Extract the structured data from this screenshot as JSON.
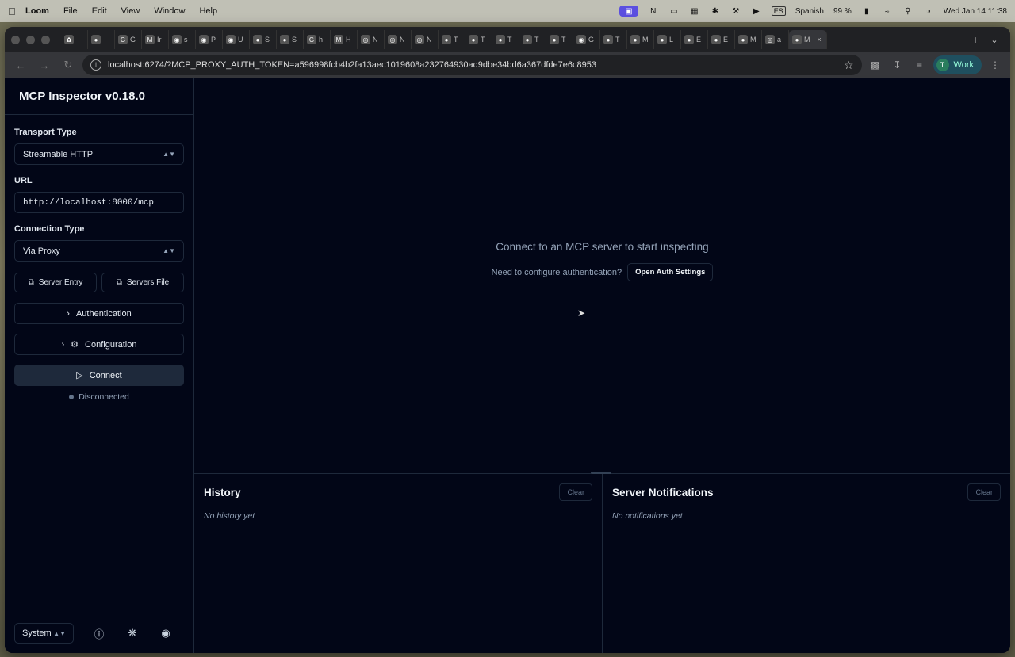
{
  "menubar": {
    "app": "Loom",
    "items": [
      "File",
      "Edit",
      "View",
      "Window",
      "Help"
    ],
    "input_source_badge": "ES",
    "input_source": "Spanish",
    "battery": "99 %",
    "datetime": "Wed Jan 14  11:38"
  },
  "browser": {
    "tabs": [
      {
        "icon": "openai-icon",
        "label": ""
      },
      {
        "icon": "app-icon",
        "label": ""
      },
      {
        "icon": "google-icon",
        "label": "G"
      },
      {
        "icon": "gmail-icon",
        "label": "Ir"
      },
      {
        "icon": "github-icon",
        "label": "s"
      },
      {
        "icon": "github-icon",
        "label": "P"
      },
      {
        "icon": "github-icon",
        "label": "U"
      },
      {
        "icon": "app-icon",
        "label": "S"
      },
      {
        "icon": "app-icon",
        "label": "S"
      },
      {
        "icon": "google-icon",
        "label": "h"
      },
      {
        "icon": "medium-icon",
        "label": "H"
      },
      {
        "icon": "globe-icon",
        "label": "N"
      },
      {
        "icon": "globe-icon",
        "label": "N"
      },
      {
        "icon": "globe-icon",
        "label": "N"
      },
      {
        "icon": "app-icon",
        "label": "T"
      },
      {
        "icon": "app-icon",
        "label": "T"
      },
      {
        "icon": "app-icon",
        "label": "T"
      },
      {
        "icon": "app-icon",
        "label": "T"
      },
      {
        "icon": "app-icon",
        "label": "T"
      },
      {
        "icon": "github-icon",
        "label": "G"
      },
      {
        "icon": "app-icon",
        "label": "T"
      },
      {
        "icon": "app-icon",
        "label": "M"
      },
      {
        "icon": "app-icon",
        "label": "L"
      },
      {
        "icon": "app-icon",
        "label": "E"
      },
      {
        "icon": "app-icon",
        "label": "E"
      },
      {
        "icon": "app-icon",
        "label": "M"
      },
      {
        "icon": "globe-icon",
        "label": "a"
      },
      {
        "icon": "app-icon",
        "label": "M",
        "active": true
      }
    ],
    "url": "localhost:6274/?MCP_PROXY_AUTH_TOKEN=a596998fcb4b2fa13aec1019608a232764930ad9dbe34bd6a367dfde7e6c8953",
    "profile_initial": "T",
    "profile_name": "Work"
  },
  "sidebar": {
    "title": "MCP Inspector v0.18.0",
    "transport_label": "Transport Type",
    "transport_value": "Streamable HTTP",
    "url_label": "URL",
    "url_value": "http://localhost:8000/mcp",
    "connection_label": "Connection Type",
    "connection_value": "Via Proxy",
    "server_entry": "Server Entry",
    "servers_file": "Servers File",
    "authentication": "Authentication",
    "configuration": "Configuration",
    "connect": "Connect",
    "status": "Disconnected",
    "theme": "System"
  },
  "main": {
    "headline": "Connect to an MCP server to start inspecting",
    "auth_prompt": "Need to configure authentication?",
    "auth_button": "Open Auth Settings"
  },
  "history": {
    "title": "History",
    "clear": "Clear",
    "empty": "No history yet"
  },
  "notifications": {
    "title": "Server Notifications",
    "clear": "Clear",
    "empty": "No notifications yet"
  },
  "colors": {
    "app_bg": "#020617",
    "border": "#1e293b",
    "accent": "#5b4fe0"
  }
}
